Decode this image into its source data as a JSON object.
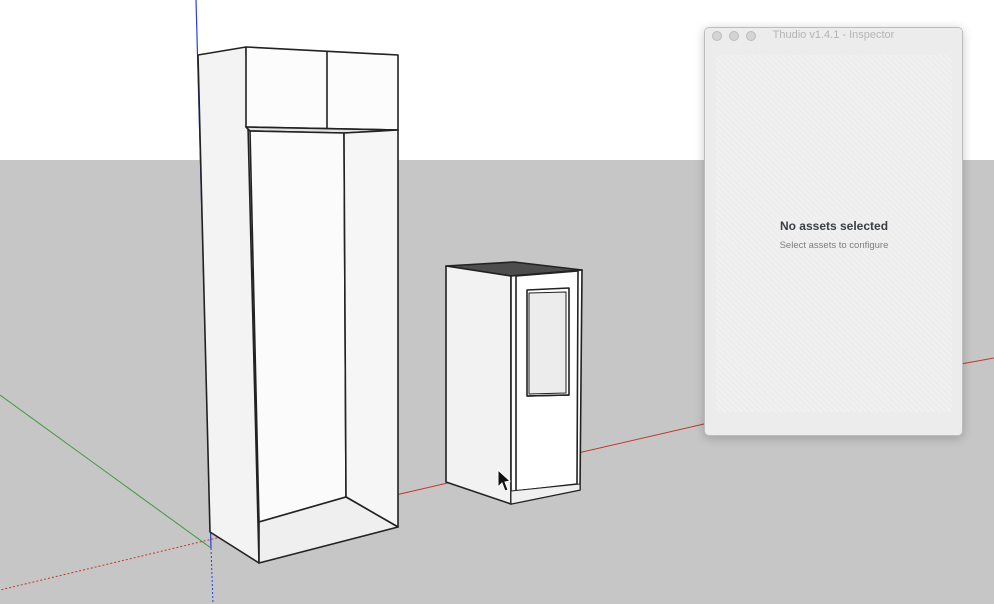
{
  "inspector": {
    "window_title": "Thudio v1.4.1 - Inspector",
    "empty_title": "No assets selected",
    "empty_subtitle": "Select assets to configure"
  },
  "viewport": {
    "sky_color": "#ffffff",
    "ground_color": "#c6c6c6",
    "axis_colors": {
      "red": "#c0392b",
      "green": "#3a9a3a",
      "blue": "#2b3fd6"
    }
  },
  "icons": {
    "cursor": "arrow-cursor-icon",
    "window_controls": [
      "close-icon",
      "minimize-icon",
      "zoom-icon"
    ]
  }
}
